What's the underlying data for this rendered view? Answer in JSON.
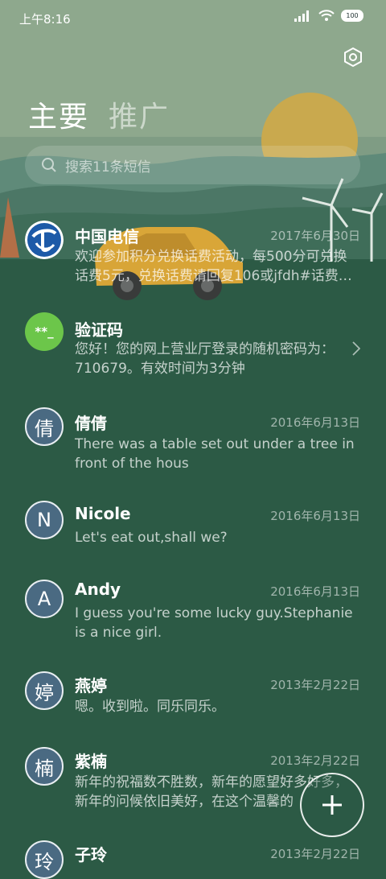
{
  "status_bar": {
    "time": "上午8:16",
    "battery": "100"
  },
  "tabs": [
    {
      "label": "主要"
    },
    {
      "label": "推广"
    }
  ],
  "search": {
    "placeholder": "搜索11条短信"
  },
  "conversations": [
    {
      "name": "中国电信",
      "date": "2017年6月30日",
      "preview": "欢迎参加积分兑换话费活动，每500分可兑换话费5元，兑换话费请回复106或jfdh#话费…"
    },
    {
      "name": "验证码",
      "avatar": "**_",
      "date": "",
      "preview": "您好！您的网上营业厅登录的随机密码为：710679。有效时间为3分钟"
    },
    {
      "name": "倩倩",
      "avatar": "倩",
      "date": "2016年6月13日",
      "preview": "There was a table set out under a tree in front of the hous"
    },
    {
      "name": "Nicole",
      "avatar": "N",
      "date": "2016年6月13日",
      "preview": "Let's eat out,shall we?"
    },
    {
      "name": "Andy",
      "avatar": "A",
      "date": "2016年6月13日",
      "preview": "I guess you're some lucky guy.Stephanie is a nice girl."
    },
    {
      "name": "燕婷",
      "avatar": "婷",
      "date": "2013年2月22日",
      "preview": "嗯。收到啦。同乐同乐。"
    },
    {
      "name": "紫楠",
      "avatar": "楠",
      "date": "2013年2月22日",
      "preview": "新年的祝福数不胜数，新年的愿望好多好多，新年的问候依旧美好，在这个温馨的"
    },
    {
      "name": "子玲",
      "avatar": "玲",
      "date": "2013年2月22日",
      "preview": ""
    }
  ],
  "colors": {
    "background": "#2c5a45",
    "sky": "#8fa88e",
    "sun": "#c9a94e",
    "verification_avatar": "#6cc64a",
    "letter_avatar": "#4a6a82"
  },
  "icons": {
    "settings": "hexagon-gear-icon",
    "search": "search-icon",
    "compose": "plus-icon",
    "chevron": "chevron-right-icon"
  }
}
